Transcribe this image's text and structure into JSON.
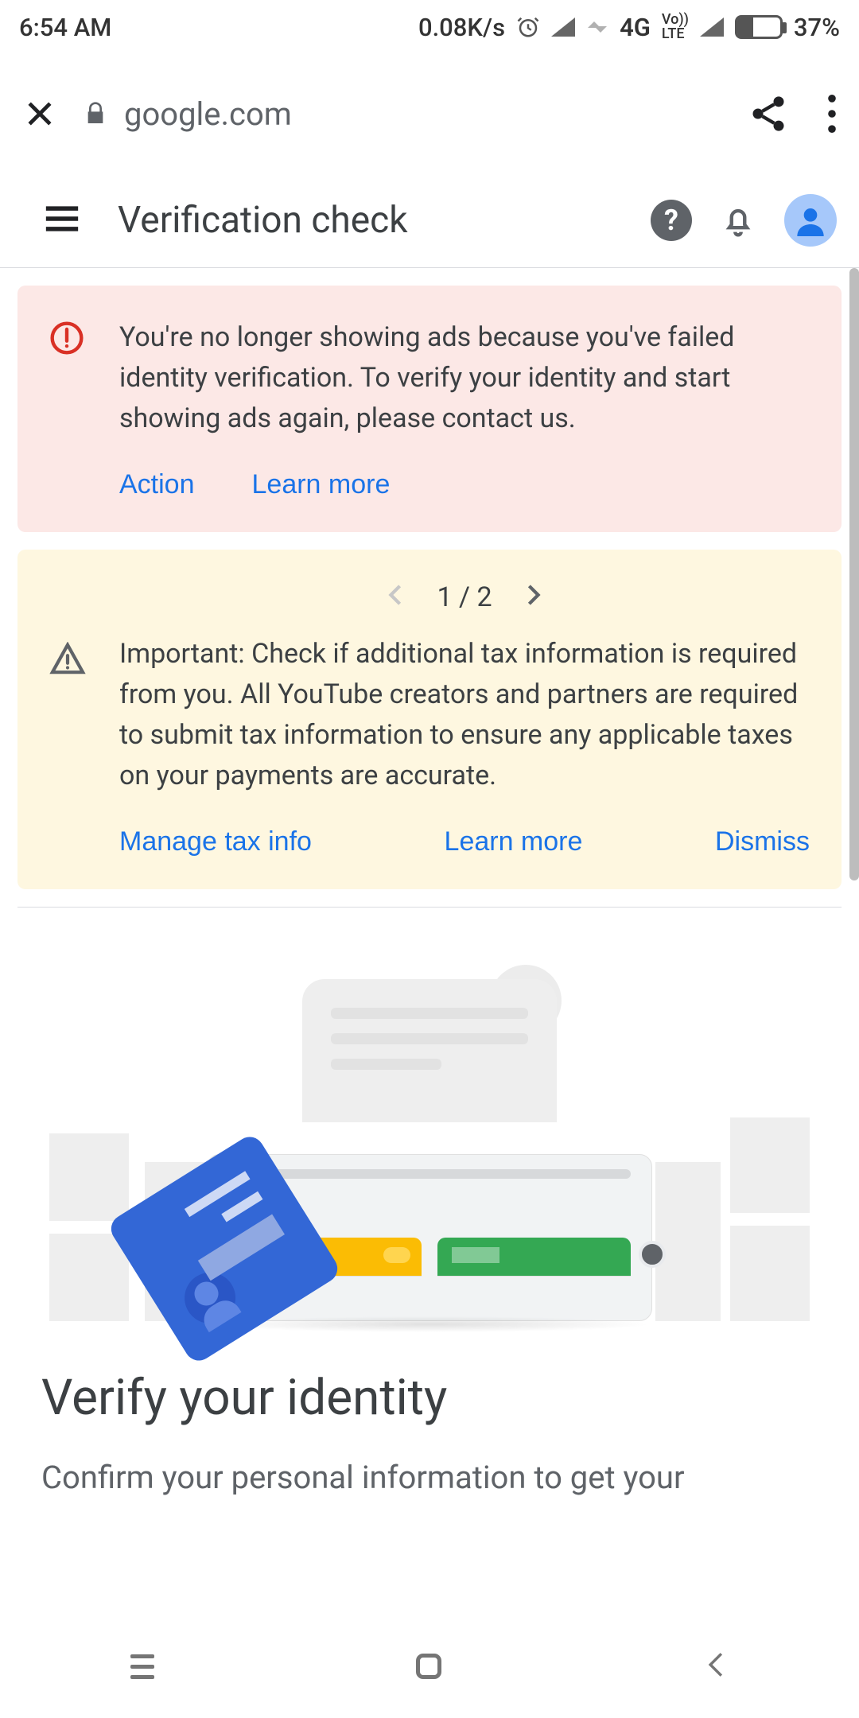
{
  "status_bar": {
    "time": "6:54 AM",
    "net_speed": "0.08K/s",
    "net_label": "4G",
    "volte": "Vo)) LTE",
    "battery_pct": "37%"
  },
  "browser": {
    "url": "google.com"
  },
  "header": {
    "title": "Verification check"
  },
  "alerts": {
    "error": {
      "text": "You're no longer showing ads because you've failed identity verification. To verify your identity and start showing ads again, please contact us.",
      "action_label": "Action",
      "learn_more_label": "Learn more"
    },
    "warn": {
      "pager_current": "1",
      "pager_total": "2",
      "pager_display": "1 / 2",
      "text": "Important: Check if additional tax information is required from you. All YouTube creators and partners are required to submit tax information to ensure any applicable taxes on your payments are accurate.",
      "manage_label": "Manage tax info",
      "learn_more_label": "Learn more",
      "dismiss_label": "Dismiss"
    }
  },
  "main": {
    "heading": "Verify your identity",
    "subheading": "Confirm your personal information to get your"
  }
}
